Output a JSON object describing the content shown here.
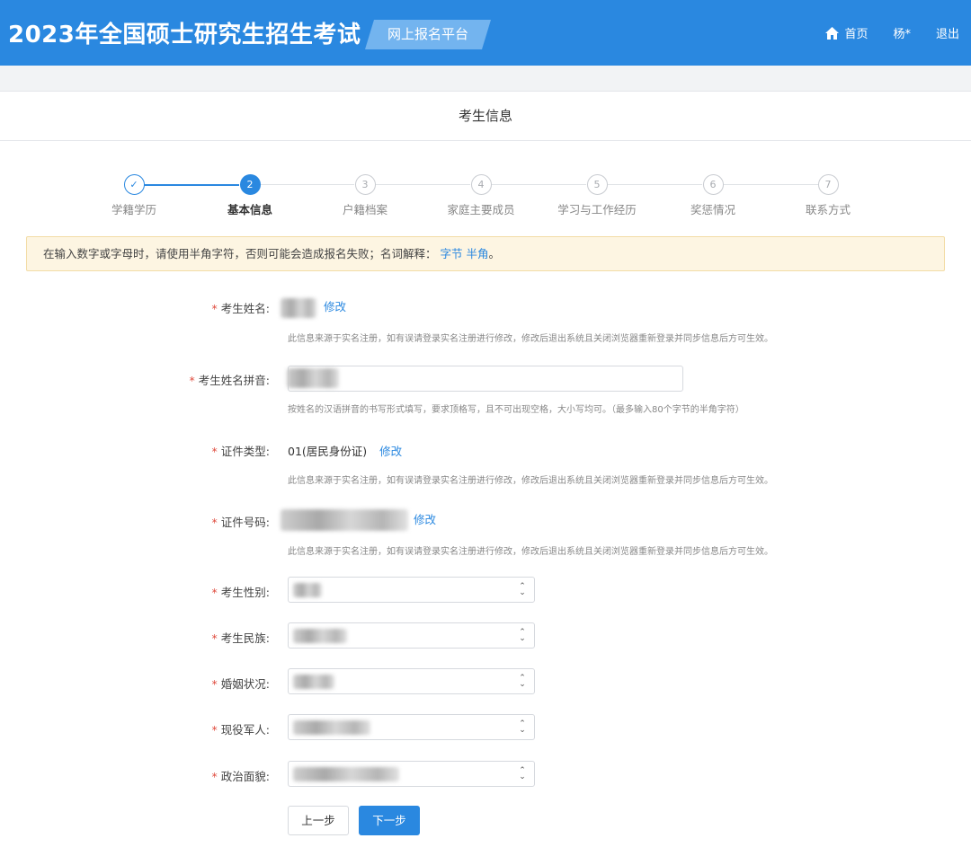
{
  "header": {
    "title": "2023年全国硕士研究生招生考试",
    "platform": "网上报名平台",
    "nav": {
      "home": "首页",
      "user": "杨*",
      "logout": "退出"
    }
  },
  "card": {
    "title": "考生信息"
  },
  "steps": [
    {
      "num": "✓",
      "label": "学籍学历",
      "state": "done"
    },
    {
      "num": "2",
      "label": "基本信息",
      "state": "active"
    },
    {
      "num": "3",
      "label": "户籍档案",
      "state": "todo"
    },
    {
      "num": "4",
      "label": "家庭主要成员",
      "state": "todo"
    },
    {
      "num": "5",
      "label": "学习与工作经历",
      "state": "todo"
    },
    {
      "num": "6",
      "label": "奖惩情况",
      "state": "todo"
    },
    {
      "num": "7",
      "label": "联系方式",
      "state": "todo"
    }
  ],
  "notice": {
    "text": "在输入数字或字母时，请使用半角字符，否则可能会造成报名失败；名词解释：",
    "link1": "字节",
    "link2": "半角",
    "end": "。"
  },
  "form": {
    "required_mark": "*",
    "name": {
      "label": "考生姓名:",
      "edit": "修改",
      "help": "此信息来源于实名注册，如有误请登录实名注册进行修改，修改后退出系统且关闭浏览器重新登录并同步信息后方可生效。"
    },
    "pinyin": {
      "label": "考生姓名拼音:",
      "help": "按姓名的汉语拼音的书写形式填写，要求顶格写，且不可出现空格，大小写均可。（最多输入80个字节的半角字符）"
    },
    "id_type": {
      "label": "证件类型:",
      "value": "01(居民身份证)",
      "edit": "修改",
      "help": "此信息来源于实名注册，如有误请登录实名注册进行修改，修改后退出系统且关闭浏览器重新登录并同步信息后方可生效。"
    },
    "id_number": {
      "label": "证件号码:",
      "edit": "修改",
      "help": "此信息来源于实名注册，如有误请登录实名注册进行修改，修改后退出系统且关闭浏览器重新登录并同步信息后方可生效。"
    },
    "gender": {
      "label": "考生性别:"
    },
    "ethnicity": {
      "label": "考生民族:"
    },
    "marital": {
      "label": "婚姻状况:"
    },
    "military": {
      "label": "现役军人:"
    },
    "political": {
      "label": "政治面貌:"
    }
  },
  "buttons": {
    "prev": "上一步",
    "next": "下一步"
  },
  "colors": {
    "primary": "#2a88e0",
    "required": "#e04c3f",
    "notice_bg": "#fdf5e2"
  }
}
